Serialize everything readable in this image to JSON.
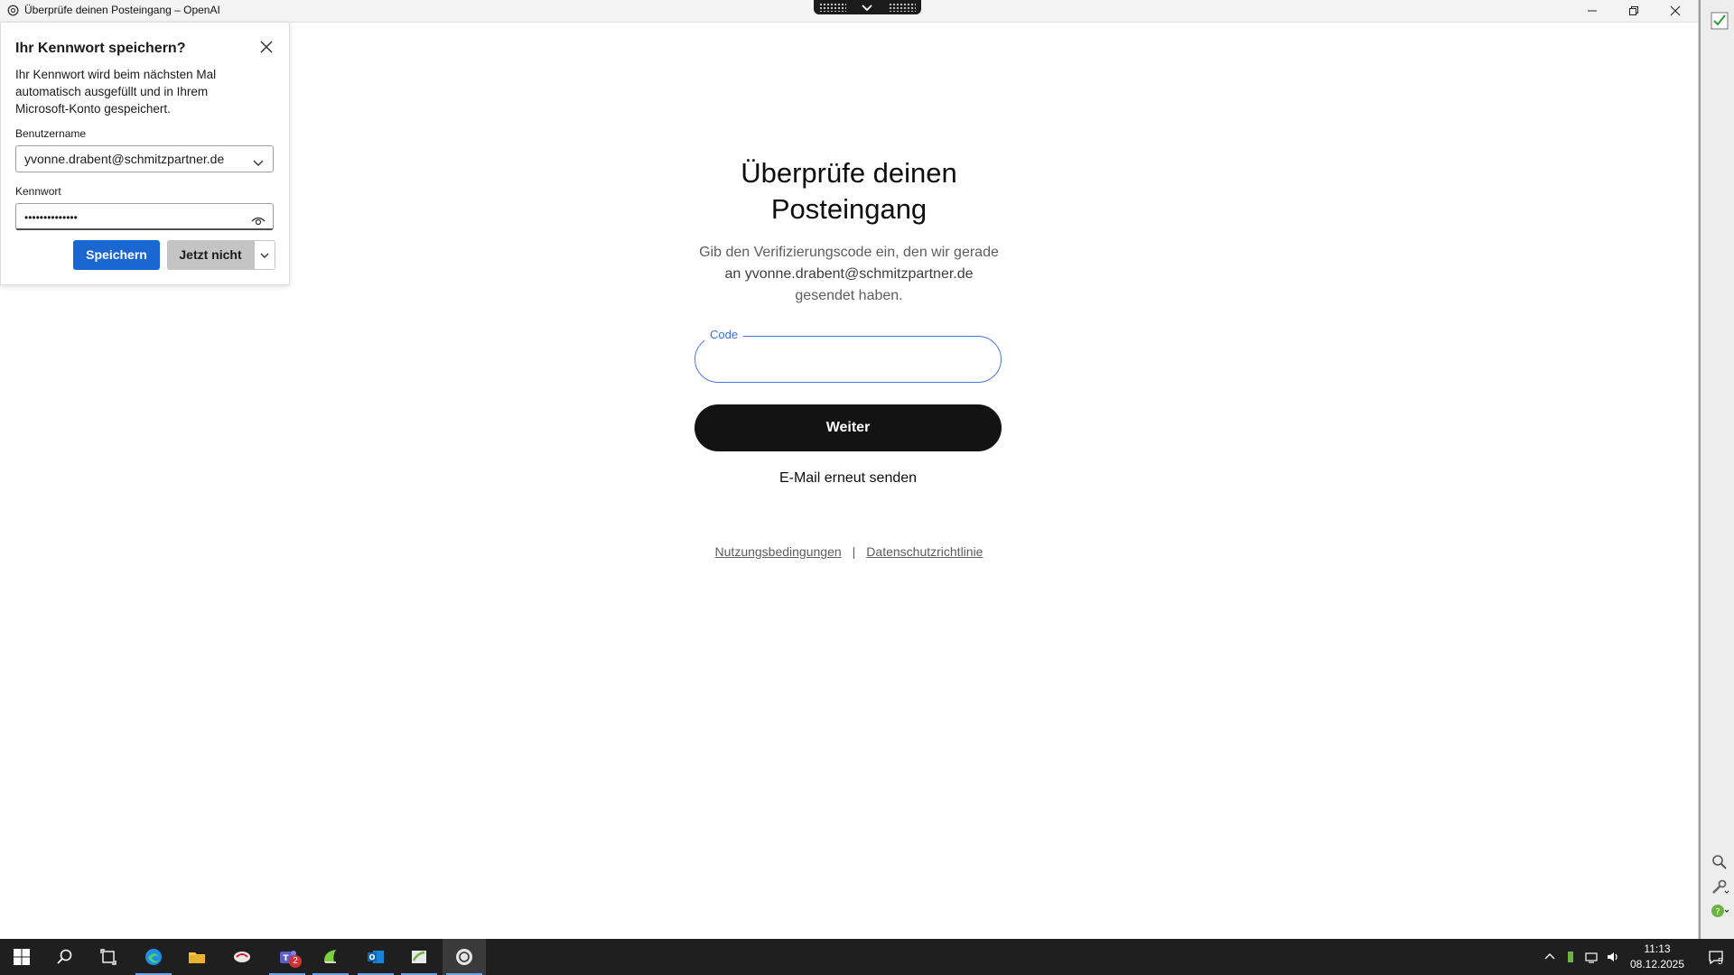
{
  "window": {
    "title": "Überprüfe deinen Posteingang – OpenAI"
  },
  "password_popup": {
    "heading": "Ihr Kennwort speichern?",
    "description": "Ihr Kennwort wird beim nächsten Mal automatisch ausgefüllt und in Ihrem Microsoft-Konto gespeichert.",
    "username_label": "Benutzername",
    "username_value": "yvonne.drabent@schmitzpartner.de",
    "password_label": "Kennwort",
    "password_value": "••••••••••••••",
    "save_label": "Speichern",
    "not_now_label": "Jetzt nicht"
  },
  "main": {
    "title": "Überprüfe deinen Posteingang",
    "subtitle_line1": "Gib den Verifizierungscode ein, den wir gerade",
    "subtitle_line2": "an yvonne.drabent@schmitzpartner.de",
    "subtitle_line3": "gesendet haben.",
    "code_label": "Code",
    "code_value": "",
    "continue_label": "Weiter",
    "resend_label": "E-Mail erneut senden",
    "terms_label": "Nutzungsbedingungen",
    "separator": "|",
    "privacy_label": "Datenschutzrichtlinie"
  },
  "taskbar": {
    "teams_badge": "2",
    "time": "11:13",
    "date": "08.12.2025",
    "notification_count": "5"
  },
  "colors": {
    "accent_blue": "#1a67d2",
    "input_focus": "#4a73e8",
    "button_dark": "#131313"
  }
}
